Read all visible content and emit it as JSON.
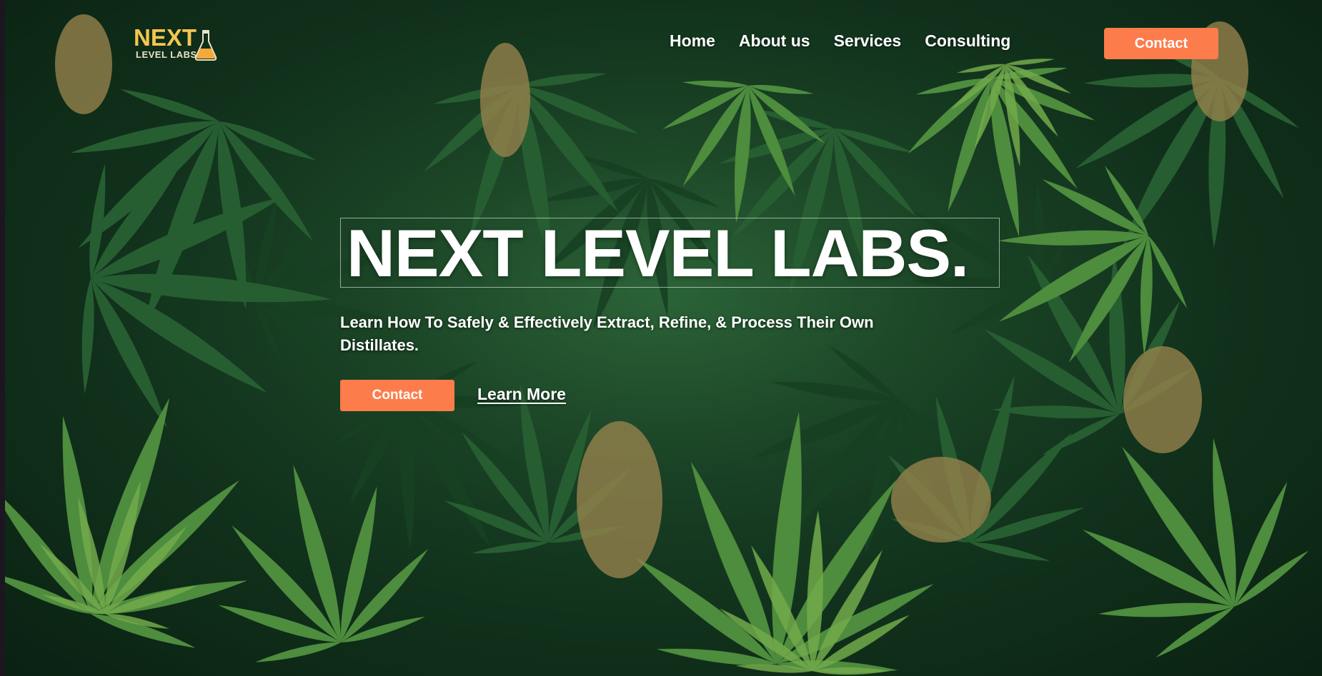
{
  "header": {
    "logo": {
      "primary": "NEXT",
      "secondary": "LEVEL LABS"
    },
    "nav": [
      {
        "label": "Home"
      },
      {
        "label": "About us"
      },
      {
        "label": "Services"
      },
      {
        "label": "Consulting"
      }
    ],
    "contact_label": "Contact"
  },
  "hero": {
    "title": "NEXT LEVEL LABS.",
    "subtitle": "Learn How To Safely & Effectively Extract, Refine, & Process Their Own Distillates.",
    "contact_label": "Contact",
    "learn_more_label": "Learn More",
    "background": "cannabis-leaves-photo"
  },
  "colors": {
    "accent": "#fd7c4b",
    "logo_gold": "#f4c64f",
    "text": "#ffffff",
    "background_green": "#1f4d2c"
  }
}
